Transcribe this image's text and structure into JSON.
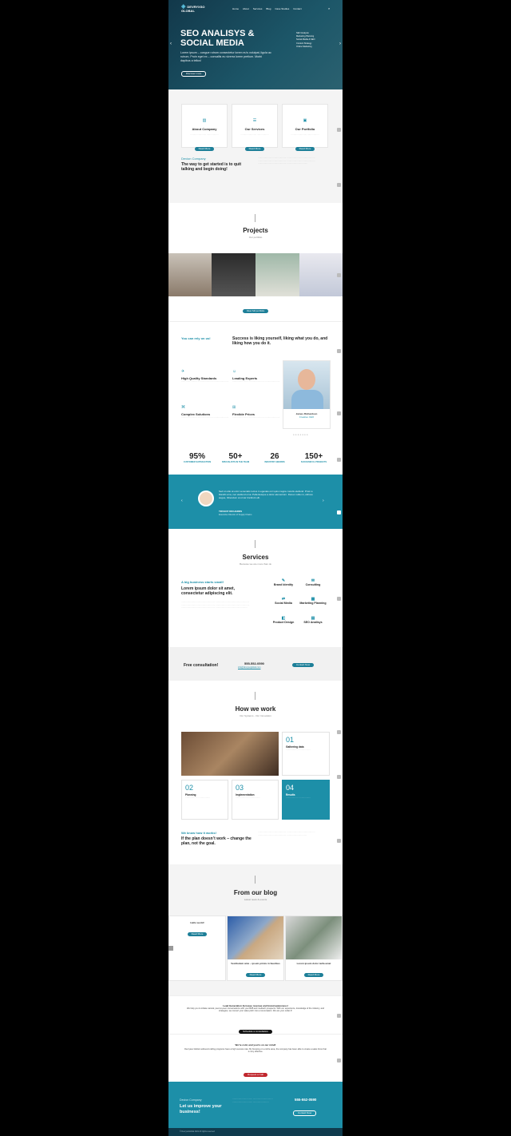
{
  "header": {
    "brand": "DEVRYXSO GLOBAL",
    "nav": [
      "Home",
      "About",
      "Services",
      "Blog",
      "Case Studies",
      "Contact"
    ]
  },
  "hero": {
    "title": "SEO ANALISYS & SOCIAL MEDIA",
    "text": "Lorem ipsum – congue rutrum consectetur lorem eu's volutpat, ligula ac rutrum, Proin eget ex – convallis eu viverra lorem pretium. Morbi dapibus a tellus!",
    "button": "Discover more",
    "side_list": [
      "SEO Analysis",
      "Marketing Planning",
      "Social Media & SEO",
      "Content Strategy",
      "Online Marketing"
    ]
  },
  "features": [
    {
      "title": "About Company",
      "button": "Read More"
    },
    {
      "title": "Our Services",
      "button": "Read More"
    },
    {
      "title": "Our Portfolio",
      "button": "Read More"
    }
  ],
  "intro": {
    "kicker": "Devion Company",
    "heading": "The way to get started is to quit talking and begin doing!"
  },
  "projects": {
    "title": "Projects",
    "subtitle": "Our portfolio",
    "button": "View full portfolio"
  },
  "why": {
    "kicker": "You can rely on us!",
    "heading": "Success is liking yourself, liking what you do, and liking how you do it.",
    "items": [
      "High Quality Standards",
      "Leading Experts",
      "Complex Solutions",
      "Flexible Prices"
    ],
    "person_name": "James Richardson",
    "person_role": "Creative CEO"
  },
  "stats": [
    {
      "n": "95%",
      "l": "CUSTOMER SATISFACTION"
    },
    {
      "n": "50+",
      "l": "SPECIALISTS IN THE TEAM"
    },
    {
      "n": "26",
      "l": "INDUSTRY AWARDS"
    },
    {
      "n": "150+",
      "l": "SUCCESSFUL PROJECTS"
    }
  ],
  "testimonial": {
    "quote": "Sed ut odio at enim venenatis luctus in egestas orci quis magna. Iaculis eleifend. Proin a blandit urna, nec eleifend urna. Pellentesque a dolor elementum. Donec nulla mi, ultrices augue, bibendum at ornar tincidunt elit.",
    "name": "TIFFANY RICHARDS",
    "role": "Executive Director of Supply Chains"
  },
  "services": {
    "title": "Services",
    "subtitle": "Because we are more than ok",
    "kicker": "A big business starts small!",
    "heading": "Lorem ipsum dolor sit amet, consectetur adipiscing elit.",
    "items": [
      "Brand Identity",
      "Consulting",
      "Social Media",
      "Marketing Planning",
      "Product Design",
      "SEO Analisys"
    ]
  },
  "consult": {
    "label": "Free consultation!",
    "phone": "555-552-0590",
    "email": "info@devrysoglobal.com",
    "button": "Contact Now"
  },
  "how": {
    "title": "How we work",
    "subtitle": "Our Systems - Our Innovation",
    "steps": [
      {
        "num": "01",
        "name": "Gathering data"
      },
      {
        "num": "02",
        "name": "Planning"
      },
      {
        "num": "03",
        "name": "Implementation"
      },
      {
        "num": "04",
        "name": "Results"
      }
    ],
    "kicker": "We know how it works!",
    "heading": "If the plan doesn’t work – change the plan, not the goal."
  },
  "blog": {
    "title": "From our blog",
    "subtitle": "Latest news & events",
    "posts": [
      {
        "title": "Hello world!",
        "button": "Read More"
      },
      {
        "title": "Vestibulum ante – ipsum primis in faucibus",
        "button": "Read More"
      },
      {
        "title": "Lorem ipsum dolor nulla amet",
        "button": "Read More"
      }
    ]
  },
  "leadgen": {
    "title": "Lead Generation Increase revenue and brand awareness!",
    "text": "We help you to initiate natural, peer-to-peer conversations with your B2B and medtech prospects. With our experience, knowledge of the industry, and strategies, we convert your sales pitch into a conversation. We are your outlet 4!",
    "button": "Schedule a consultation"
  },
  "call": {
    "title": "We're cold, and you're on our mind!",
    "text": "Devrysso Global outbound calling programs have a high success rate. By focusing on a niche area, the company has been able to create a sales force that is very effective.",
    "button": "Request a Call"
  },
  "footer_cta": {
    "kicker": "Devion Company",
    "heading": "Let us improve your business!",
    "phone": "555-552-0590",
    "button": "Contact Now"
  },
  "footer": {
    "text": "© DevrysoGlobal 2021 All rights reserved"
  },
  "colors": {
    "teal": "#1d7f98",
    "dark": "#0f3b4d"
  }
}
